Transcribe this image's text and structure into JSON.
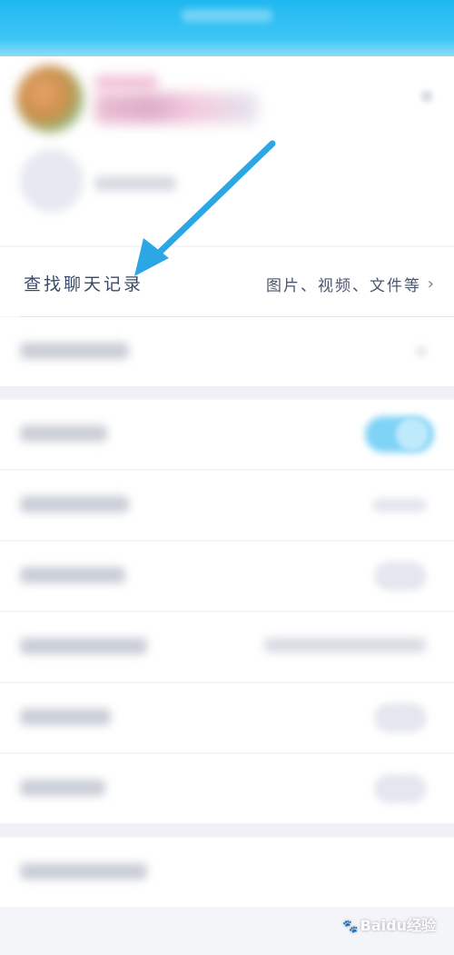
{
  "search_row": {
    "label": "查找聊天记录",
    "hint": "图片、视频、文件等",
    "chevron": "›"
  },
  "watermark": {
    "text": "Baidu经验",
    "paw": "🐾"
  },
  "colors": {
    "header": "#1fb8f0",
    "arrow": "#2aa7e4"
  },
  "icons": [
    "chevron-right-icon",
    "arrow-annotation-icon",
    "baidu-paw-icon"
  ]
}
